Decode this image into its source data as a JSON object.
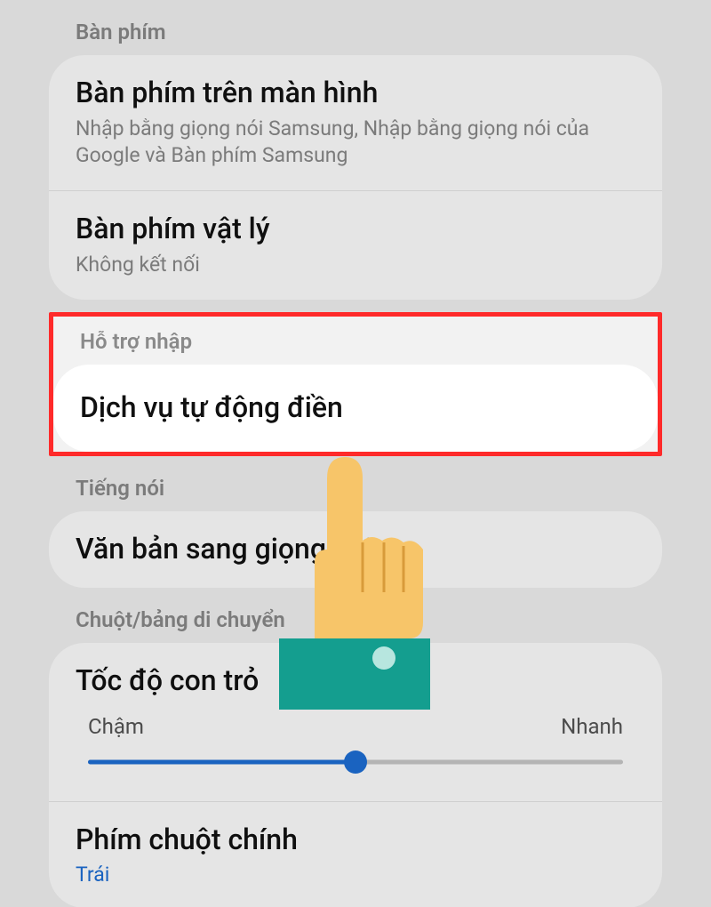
{
  "sections": {
    "keyboard": {
      "header": "Bàn phím",
      "onscreen": {
        "title": "Bàn phím trên màn hình",
        "sub": "Nhập bằng giọng nói Samsung, Nhập bằng giọng nói của Google và Bàn phím Samsung"
      },
      "physical": {
        "title": "Bàn phím vật lý",
        "sub": "Không kết nối"
      }
    },
    "input_assist": {
      "header": "Hỗ trợ nhập",
      "autofill": {
        "title": "Dịch vụ tự động điền"
      }
    },
    "speech": {
      "header": "Tiếng nói",
      "tts": {
        "title": "Văn bản sang giọng nói"
      }
    },
    "pointer": {
      "header": "Chuột/bảng di chuyển",
      "speed": {
        "title": "Tốc độ con trỏ",
        "slow": "Chậm",
        "fast": "Nhanh",
        "percent": 50
      },
      "primary_button": {
        "title": "Phím chuột chính",
        "value": "Trái"
      }
    }
  }
}
